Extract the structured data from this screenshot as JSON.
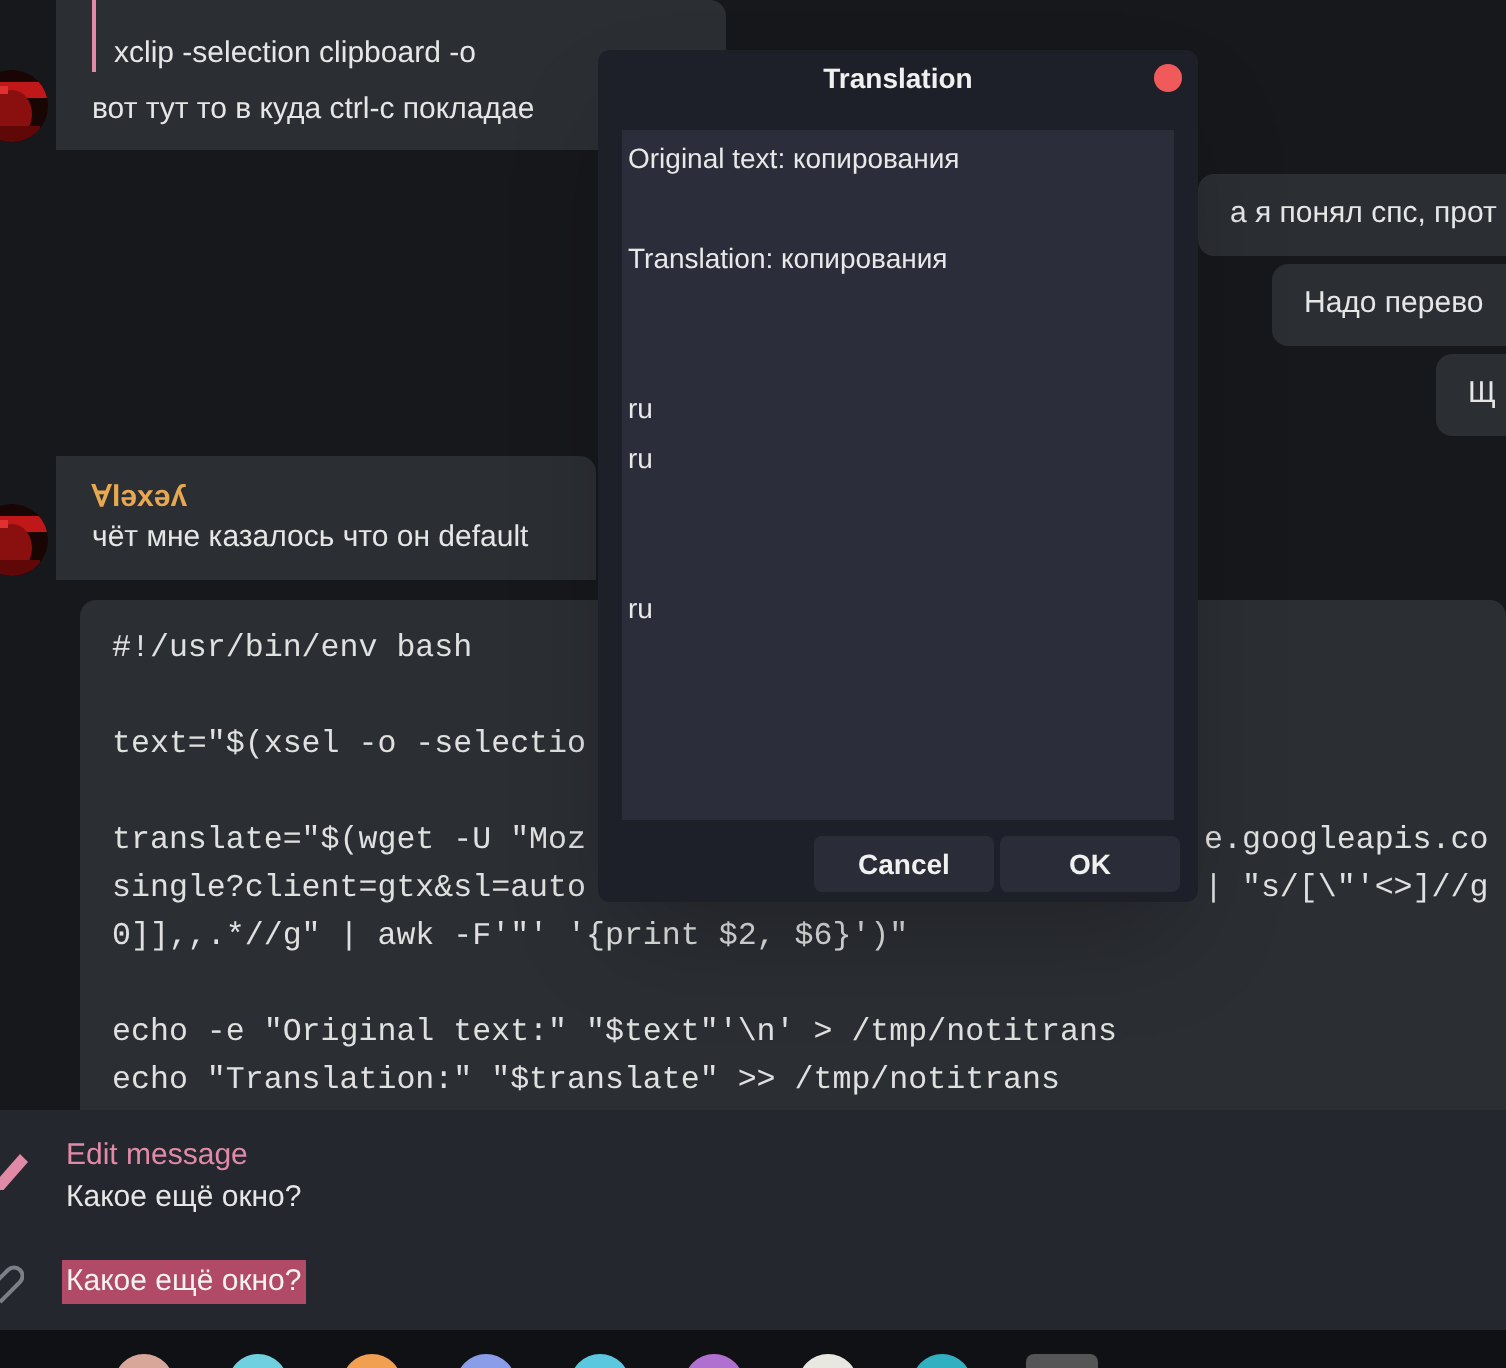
{
  "messages_left": [
    {
      "quote": {
        "text": "xclip -selection clipboard -o"
      },
      "text": "вот тут то в куда ctrl-c покладае"
    },
    {
      "author": "Ɐləxəʎ",
      "text": "чёт мне казалось что он default"
    }
  ],
  "messages_right": [
    "а я понял спс, прот",
    "Надо перево",
    "Щ"
  ],
  "code_block": [
    [
      {
        "text": "#!/usr/bin/env bash"
      }
    ],
    [
      {
        "text": "text=\"$(xsel -o -selectio"
      }
    ],
    [
      {
        "text": "translate=\"$(wget -U \"Moz",
        "right": "e.googleapis.co"
      },
      {
        "text": "single?client=gtx&sl=auto",
        "right": "| \"s/[\\\"'<>]//g"
      },
      {
        "text": "0]],,.*//g\" | awk -F'\"' '{print $2, $6}')\""
      }
    ],
    [
      {
        "text": "echo -e \"Original text:\" \"$text\"'\\n' > /tmp/notitrans"
      },
      {
        "text": "echo \"Translation:\" \"$translate\" >> /tmp/notitrans"
      }
    ]
  ],
  "edit_panel": {
    "title": "Edit message",
    "original": "Какое ещё окно?",
    "value": "Какое ещё окно?"
  },
  "dialog": {
    "title": "Translation",
    "text": "Original text: копирования\n\nTranslation: копирования\n\n\nru\nru\n\n\nru",
    "buttons": [
      "Cancel",
      "OK"
    ]
  }
}
